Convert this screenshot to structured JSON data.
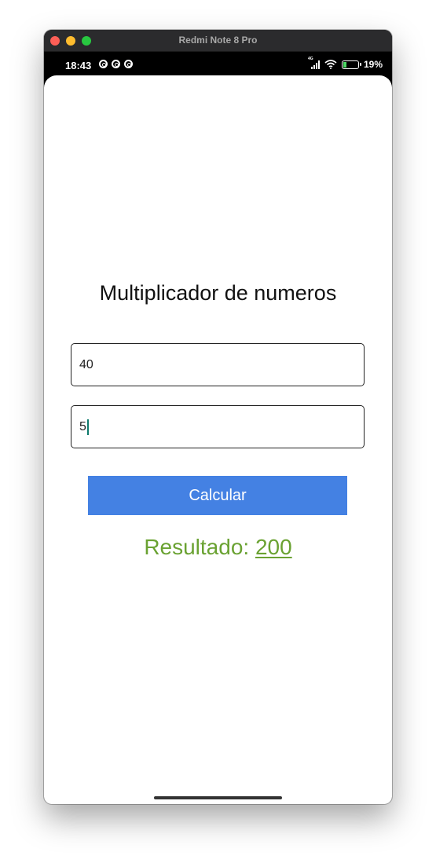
{
  "window": {
    "title": "Redmi Note 8 Pro"
  },
  "statusbar": {
    "time": "18:43",
    "network": "4G",
    "battery": "19%"
  },
  "app": {
    "title": "Multiplicador de numeros",
    "input1_value": "40",
    "input2_value": "5",
    "button_label": "Calcular",
    "result_label": "Resultado: ",
    "result_value": "200"
  },
  "colors": {
    "button": "#4481e3",
    "result": "#6aa232"
  }
}
